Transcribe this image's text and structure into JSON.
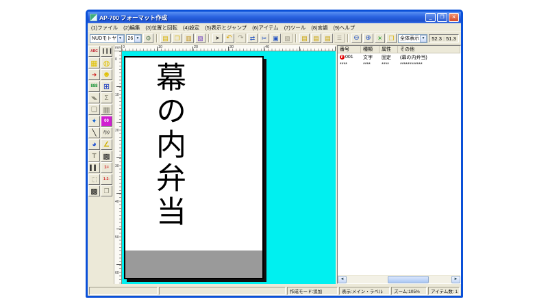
{
  "window": {
    "title": "AP-700 フォーマット作成",
    "controls": {
      "minimize": "_",
      "restore": "❐",
      "close": "✕"
    }
  },
  "menu": {
    "items": [
      {
        "name": "menu-file",
        "label": "(1)ファイル"
      },
      {
        "name": "menu-edit",
        "label": "(2)編集"
      },
      {
        "name": "menu-position-rotate",
        "label": "(3)位置と回転"
      },
      {
        "name": "menu-settings",
        "label": "(4)設定"
      },
      {
        "name": "menu-view-jump",
        "label": "(5)表示とジャンプ"
      },
      {
        "name": "menu-item",
        "label": "(6)アイテム"
      },
      {
        "name": "menu-tool",
        "label": "(7)ツール"
      },
      {
        "name": "menu-language",
        "label": "(8)言語"
      },
      {
        "name": "menu-help",
        "label": "(9)ヘルプ"
      }
    ]
  },
  "toolbar": {
    "font_combo": "NUDモトヤEX明朝",
    "size_combo": "26",
    "view_combo": "全体表示",
    "coords": "52.3 : 51.3",
    "dropdown_arrow": "▼",
    "buttons": [
      {
        "name": "font-setup-button",
        "glyph": "⚙",
        "color": "#557755",
        "fs": 9
      },
      {
        "sep": true
      },
      {
        "name": "new-button",
        "glyph": "▤",
        "color": "#d8b000",
        "fs": 9
      },
      {
        "name": "open-button",
        "glyph": "❒",
        "color": "#d8b000",
        "fs": 9
      },
      {
        "name": "save-button",
        "glyph": "▥",
        "color": "#c09020",
        "fs": 9
      },
      {
        "name": "import-button",
        "glyph": "▧",
        "color": "#7040c0",
        "fs": 9
      },
      {
        "sep": true
      },
      {
        "name": "select-button",
        "glyph": "➤",
        "color": "#333333",
        "fs": 8
      },
      {
        "name": "undo-button",
        "glyph": "↶",
        "color": "#d8a000",
        "fs": 10
      },
      {
        "name": "redo-button",
        "glyph": "↷",
        "color": "#9a9686",
        "fs": 10,
        "disabled": true
      },
      {
        "name": "move-item-button",
        "glyph": "⇄",
        "color": "#2050c0",
        "fs": 9
      },
      {
        "name": "cut-button",
        "glyph": "✂",
        "color": "#2050c0",
        "fs": 9
      },
      {
        "name": "copy-button",
        "glyph": "▣",
        "color": "#2050c0",
        "fs": 9
      },
      {
        "name": "paste-button",
        "glyph": "▨",
        "color": "#9a9686",
        "fs": 9,
        "disabled": true
      },
      {
        "sep": true
      },
      {
        "name": "align-page1-button",
        "glyph": "▤",
        "color": "#c8a000",
        "fs": 9
      },
      {
        "name": "align-page2-button",
        "glyph": "▤",
        "color": "#c8a000",
        "fs": 9
      },
      {
        "name": "align-page3-button",
        "glyph": "▤",
        "color": "#c8a000",
        "fs": 9
      },
      {
        "name": "list-view-button",
        "glyph": "☰",
        "color": "#9a9686",
        "fs": 8,
        "disabled": true
      },
      {
        "sep": true
      },
      {
        "name": "zoom-out-button",
        "glyph": "⊖",
        "color": "#2050c0",
        "fs": 10
      },
      {
        "name": "zoom-in-button",
        "glyph": "⊕",
        "color": "#2050c0",
        "fs": 10
      },
      {
        "name": "hint-lamp-button",
        "glyph": "☀",
        "color": "#30a030",
        "fs": 9
      },
      {
        "name": "view-folder-button",
        "glyph": "❒",
        "color": "#d8b000",
        "fs": 9
      }
    ]
  },
  "palette": {
    "buttons": [
      {
        "name": "text-tool",
        "glyph": "ABC",
        "color": "#c02030",
        "fs": 5,
        "bold": true
      },
      {
        "name": "barcode-tool",
        "glyph": "▎▎▎▎",
        "color": "#222222",
        "fs": 7
      },
      {
        "name": "grid-tool",
        "glyph": "▦",
        "color": "#e0c000",
        "fs": 11
      },
      {
        "name": "print-tool",
        "glyph": "◍",
        "color": "#e0c000",
        "fs": 11
      },
      {
        "name": "arrow-line-tool",
        "glyph": "➜",
        "color": "#d02020",
        "fs": 9
      },
      {
        "name": "smiley-tool",
        "glyph": "☻",
        "color": "#e0c000",
        "fs": 11
      },
      {
        "name": "segment-display-tool",
        "glyph": "888",
        "color": "#109030",
        "fs": 6,
        "bold": true
      },
      {
        "name": "calculator-tool",
        "glyph": "⊞",
        "color": "#2040c0",
        "fs": 11
      },
      {
        "name": "triangle-tool",
        "glyph": "◥◣",
        "color": "#8a8878",
        "fs": 6,
        "disabled": true
      },
      {
        "name": "sigma-tool",
        "glyph": "Σ",
        "color": "#8a8878",
        "fs": 10,
        "disabled": true
      },
      {
        "name": "layers-tool",
        "glyph": "❏",
        "color": "#8a8878",
        "fs": 10,
        "disabled": true
      },
      {
        "name": "table-tool",
        "glyph": "▦",
        "color": "#8a8878",
        "fs": 11,
        "disabled": true
      },
      {
        "name": "spray-tool",
        "glyph": "✦",
        "color": "#1060d0",
        "fs": 10
      },
      {
        "name": "counter-tool",
        "glyph": "00",
        "color": "#ffffff",
        "bg": "#d020d0",
        "fs": 6,
        "bold": true
      },
      {
        "name": "line-tool",
        "glyph": "╲",
        "color": "#111111",
        "fs": 10
      },
      {
        "name": "function-tool",
        "glyph": "f(x)",
        "color": "#111111",
        "fs": 6,
        "italic": true
      },
      {
        "name": "color-pie-tool",
        "glyph": "◕",
        "color": "#2050d0",
        "fs": 11
      },
      {
        "name": "angle-tool",
        "glyph": "∠",
        "color": "#d0b000",
        "fs": 10,
        "bold": true
      },
      {
        "name": "text-frame-tool",
        "glyph": "T",
        "color": "#8a8878",
        "fs": 10,
        "bold": true,
        "disabled": true
      },
      {
        "name": "qr-code-tool",
        "glyph": "▩",
        "color": "#222222",
        "fs": 11
      },
      {
        "name": "barcode2-tool",
        "glyph": "▍▍",
        "color": "#222222",
        "fs": 8
      },
      {
        "name": "numbered-list-tool",
        "glyph": "1=",
        "color": "#d02020",
        "fs": 6,
        "bold": true
      },
      {
        "name": "frame-tool",
        "glyph": "⬚",
        "color": "#8a8878",
        "fs": 9,
        "disabled": true
      },
      {
        "name": "sequence-tool",
        "glyph": "1-2-",
        "color": "#d02020",
        "fs": 5,
        "bold": true
      },
      {
        "name": "datamatrix-tool",
        "glyph": "▩",
        "color": "#111111",
        "fs": 11
      },
      {
        "name": "folder-copy-tool",
        "glyph": "❐",
        "color": "#8a8878",
        "fs": 9,
        "disabled": true
      }
    ]
  },
  "rulers": {
    "unit": "mm",
    "h_numbers": [
      "0",
      "10",
      "20",
      "30",
      "40"
    ],
    "v_numbers": [
      "0",
      "10",
      "20",
      "30",
      "40",
      "50",
      "60"
    ]
  },
  "canvas": {
    "background_color": "#00f0f0",
    "label_text": "幕の内弁当",
    "gray_band_color": "#9a9a9a"
  },
  "item_list": {
    "headers": [
      "番号",
      "種類",
      "属性",
      "その他"
    ],
    "rows": [
      {
        "badge": "P",
        "num": "001",
        "type": "文字",
        "attr": "固定",
        "other": "(幕の内弁当)"
      },
      {
        "badge": "",
        "num": "****",
        "type": "****",
        "attr": "****",
        "other": "************"
      }
    ],
    "scroll_left_arrow": "◄",
    "scroll_right_arrow": "►"
  },
  "status_bar": {
    "mode": "作成モード:追加",
    "view": "表示:メイン・ラベル",
    "zoom": "ズーム:105%",
    "items": "アイテム数:  1"
  }
}
